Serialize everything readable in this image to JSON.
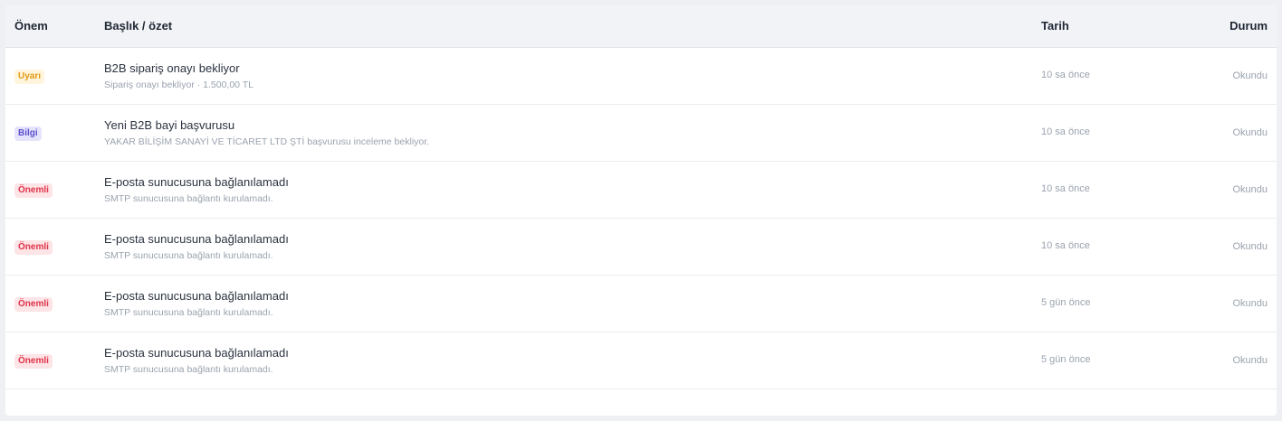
{
  "table": {
    "headers": {
      "importance": "Önem",
      "title": "Başlık / özet",
      "date": "Tarih",
      "status": "Durum"
    },
    "rows": [
      {
        "importance": "Uyarı",
        "importance_level": "warn",
        "title": "B2B sipariş onayı bekliyor",
        "summary": "Sipariş onayı bekliyor · 1.500,00 TL",
        "date": "10 sa önce",
        "status": "Okundu"
      },
      {
        "importance": "Bilgi",
        "importance_level": "info",
        "title": "Yeni B2B bayi başvurusu",
        "summary": "YAKAR BİLİŞİM SANAYİ VE TİCARET LTD ŞTİ başvurusu inceleme bekliyor.",
        "date": "10 sa önce",
        "status": "Okundu"
      },
      {
        "importance": "Önemli",
        "importance_level": "crit",
        "title": "E-posta sunucusuna bağlanılamadı",
        "summary": "SMTP sunucusuna bağlantı kurulamadı.",
        "date": "10 sa önce",
        "status": "Okundu"
      },
      {
        "importance": "Önemli",
        "importance_level": "crit",
        "title": "E-posta sunucusuna bağlanılamadı",
        "summary": "SMTP sunucusuna bağlantı kurulamadı.",
        "date": "10 sa önce",
        "status": "Okundu"
      },
      {
        "importance": "Önemli",
        "importance_level": "crit",
        "title": "E-posta sunucusuna bağlanılamadı",
        "summary": "SMTP sunucusuna bağlantı kurulamadı.",
        "date": "5 gün önce",
        "status": "Okundu"
      },
      {
        "importance": "Önemli",
        "importance_level": "crit",
        "title": "E-posta sunucusuna bağlanılamadı",
        "summary": "SMTP sunucusuna bağlantı kurulamadı.",
        "date": "5 gün önce",
        "status": "Okundu"
      }
    ]
  },
  "colors": {
    "warn": "#e39a17",
    "info": "#5a4fd0",
    "crit": "#e0344a"
  }
}
